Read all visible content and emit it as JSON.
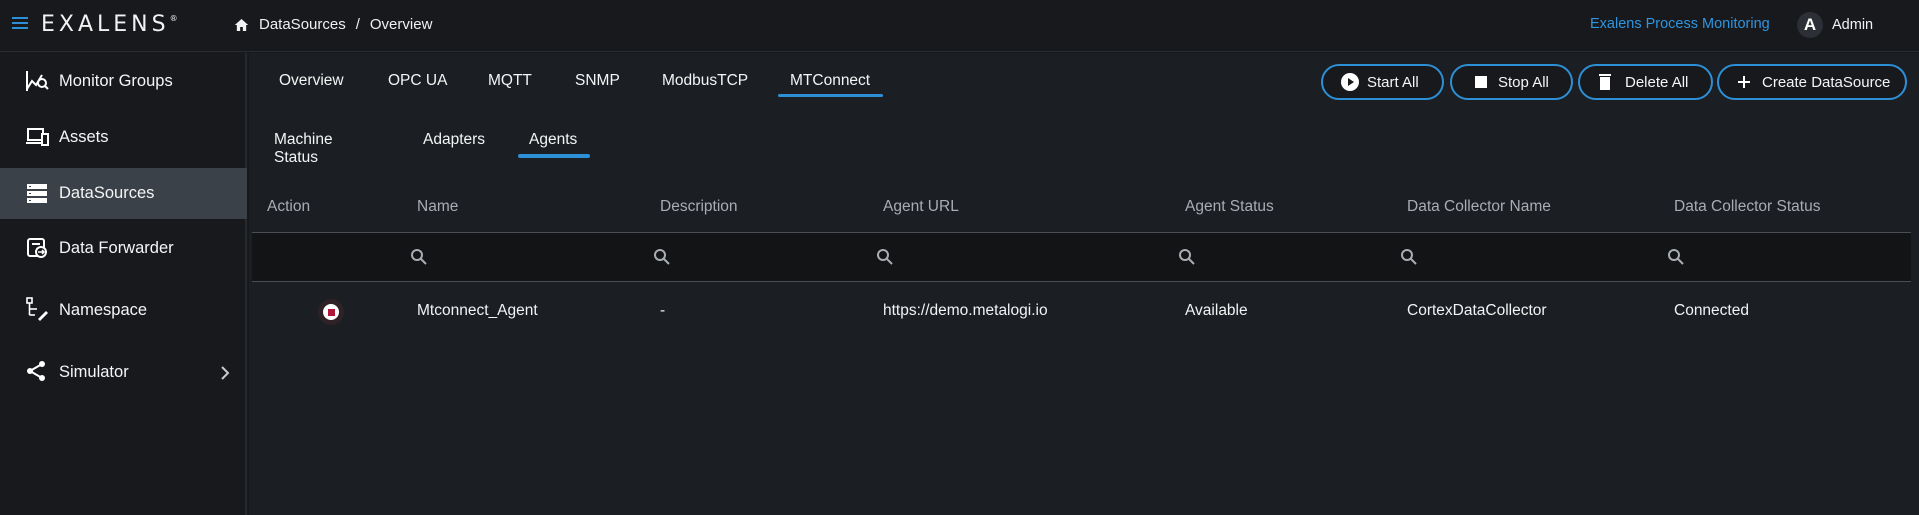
{
  "app": {
    "logo": "EXALENS",
    "logo_mark": "®",
    "brand_link": "Exalens Process Monitoring",
    "user_initial": "A",
    "user_name": "Admin"
  },
  "breadcrumb": {
    "items": [
      "DataSources",
      "Overview"
    ],
    "separator": "/"
  },
  "sidebar": {
    "items": [
      {
        "label": "Monitor Groups",
        "icon": "monitor-groups-icon"
      },
      {
        "label": "Assets",
        "icon": "assets-icon"
      },
      {
        "label": "DataSources",
        "icon": "datasources-icon",
        "active": true
      },
      {
        "label": "Data Forwarder",
        "icon": "data-forwarder-icon"
      },
      {
        "label": "Namespace",
        "icon": "namespace-icon"
      },
      {
        "label": "Simulator",
        "icon": "simulator-icon",
        "has_submenu": true
      }
    ]
  },
  "tabs": {
    "items": [
      "Overview",
      "OPC UA",
      "MQTT",
      "SNMP",
      "ModbusTCP",
      "MTConnect"
    ],
    "active": "MTConnect"
  },
  "actions": {
    "start_all": "Start All",
    "stop_all": "Stop All",
    "delete_all": "Delete All",
    "create": "Create DataSource"
  },
  "subtabs": {
    "items": [
      "Machine Status",
      "Adapters",
      "Agents"
    ],
    "active": "Agents"
  },
  "table": {
    "columns": [
      "Action",
      "Name",
      "Description",
      "Agent URL",
      "Agent Status",
      "Data Collector Name",
      "Data Collector Status"
    ],
    "rows": [
      {
        "action_icon": "stop-circle-icon",
        "name": "Mtconnect_Agent",
        "description": "-",
        "agent_url": "https://demo.metalogi.io",
        "agent_status": "Available",
        "collector_name": "CortexDataCollector",
        "collector_status": "Connected"
      }
    ]
  },
  "colors": {
    "accent": "#2d8fd6",
    "background": "#17191c",
    "active_item": "#3a4148",
    "stop": "#b0183a"
  }
}
